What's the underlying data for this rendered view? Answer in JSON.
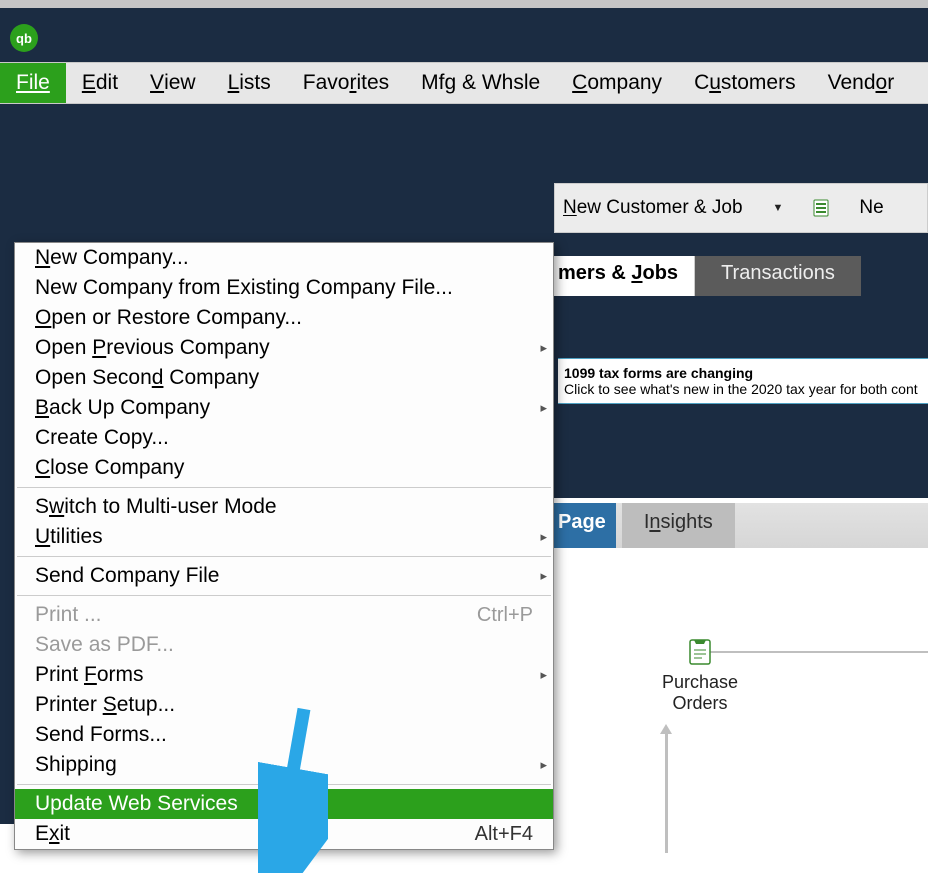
{
  "app": {
    "logo_text": "qb"
  },
  "menubar": {
    "file": "File",
    "edit": "Edit",
    "view": "View",
    "lists": "Lists",
    "favorites": "Favorites",
    "mfgwhsle": "Mfg & Whsle",
    "company": "Company",
    "customers": "Customers",
    "vendors": "Vendor"
  },
  "ribbon": {
    "new_customer_job": "New Customer & Job",
    "new_trailing": "Ne"
  },
  "tabs": {
    "customers_jobs_clip": "mers & Jobs",
    "transactions": "Transactions"
  },
  "notice": {
    "title": "1099 tax forms are changing",
    "body": "Click to see what's new in the 2020 tax year for both cont"
  },
  "page_toggle": {
    "page": "Page",
    "insights": "Insights"
  },
  "po": {
    "line1": "Purchase",
    "line2": "Orders"
  },
  "file_menu": {
    "new_company": "New Company...",
    "new_from_existing": "New Company from Existing Company File...",
    "open_restore": "Open or Restore Company...",
    "open_previous": "Open Previous Company",
    "open_second": "Open Second Company",
    "backup": "Back Up Company",
    "create_copy": "Create Copy...",
    "close_company": "Close Company",
    "switch_multi": "Switch to Multi-user Mode",
    "utilities": "Utilities",
    "send_company_file": "Send Company File",
    "print": "Print ...",
    "print_shortcut": "Ctrl+P",
    "save_pdf": "Save as PDF...",
    "print_forms": "Print Forms",
    "printer_setup": "Printer Setup...",
    "send_forms": "Send Forms...",
    "shipping": "Shipping",
    "update_web": "Update Web Services",
    "exit": "Exit",
    "exit_shortcut": "Alt+F4"
  }
}
